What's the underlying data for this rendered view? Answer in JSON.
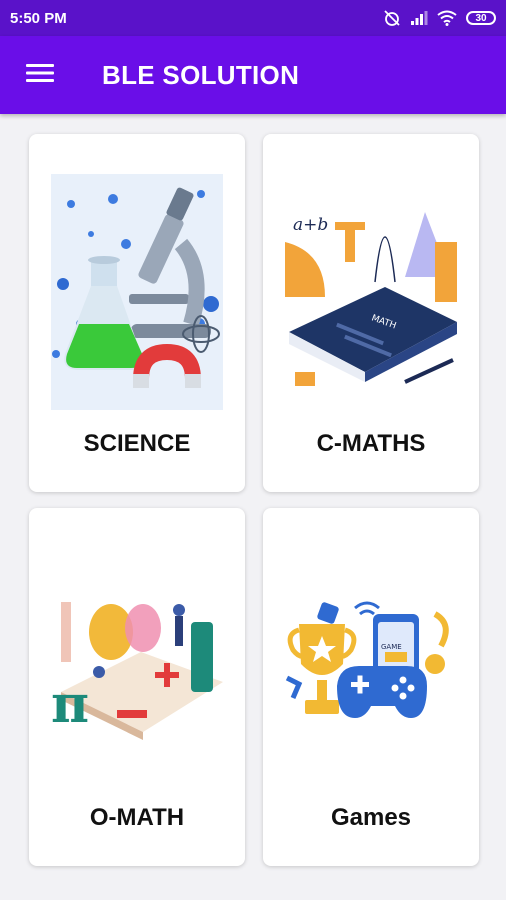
{
  "status_bar": {
    "time": "5:50 PM",
    "battery": "30"
  },
  "app_bar": {
    "title": "BLE SOLUTION"
  },
  "cards": [
    {
      "label": "SCIENCE",
      "illustration": "science-lab-icon"
    },
    {
      "label": "C-MATHS",
      "illustration": "math-book-icon"
    },
    {
      "label": "O-MATH",
      "illustration": "geometry-math-icon"
    },
    {
      "label": "Games",
      "illustration": "games-trophy-icon"
    }
  ],
  "colors": {
    "status_bar": "#5a12c9",
    "app_bar": "#6a0ee8",
    "background": "#f2f2f5",
    "card": "#ffffff"
  }
}
